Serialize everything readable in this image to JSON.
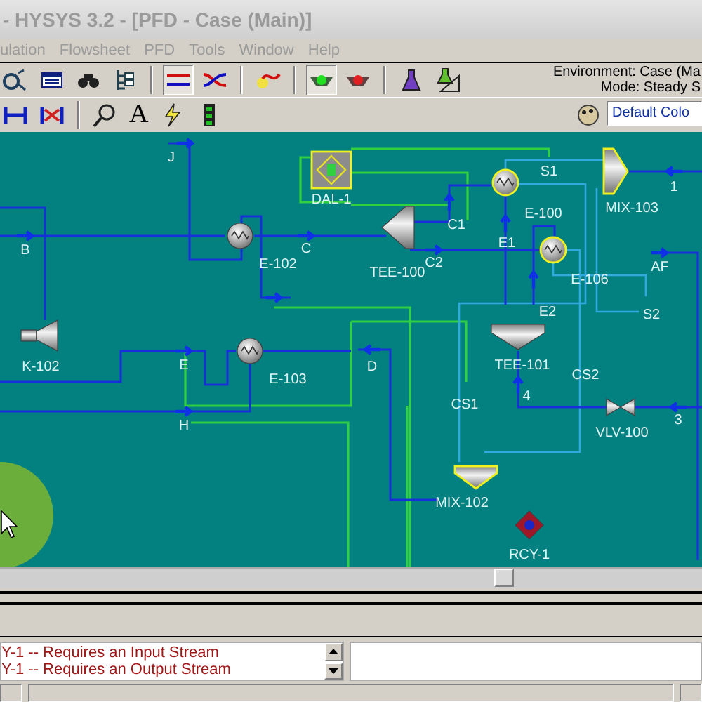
{
  "window": {
    "title": "- HYSYS 3.2 - [PFD - Case (Main)]"
  },
  "menu": [
    "ulation",
    "Flowsheet",
    "PFD",
    "Tools",
    "Window",
    "Help"
  ],
  "environment": {
    "environment": "Environment: Case (Ma",
    "mode": "Mode: Steady S"
  },
  "toolbar": {
    "text_tool": "A",
    "color_scheme": "Default Colo"
  },
  "units": [
    {
      "label": "DAL-1",
      "kind": "balance",
      "highlighted": true
    },
    {
      "label": "E-102",
      "kind": "exchanger",
      "highlighted": false
    },
    {
      "label": "E-103",
      "kind": "exchanger",
      "highlighted": false
    },
    {
      "label": "K-102",
      "kind": "compressor",
      "highlighted": false
    },
    {
      "label": "TEE-100",
      "kind": "splitter",
      "highlighted": false
    },
    {
      "label": "E-100",
      "kind": "exchanger",
      "highlighted": true
    },
    {
      "label": "E-106",
      "kind": "exchanger",
      "highlighted": true
    },
    {
      "label": "TEE-101",
      "kind": "splitter",
      "highlighted": false
    },
    {
      "label": "MIX-103",
      "kind": "mixer",
      "highlighted": true
    },
    {
      "label": "MIX-102",
      "kind": "mixer",
      "highlighted": true
    },
    {
      "label": "VLV-100",
      "kind": "valve",
      "highlighted": false
    },
    {
      "label": "RCY-1",
      "kind": "recycle",
      "highlighted": false
    }
  ],
  "streams": [
    {
      "label": "J"
    },
    {
      "label": "B"
    },
    {
      "label": "C"
    },
    {
      "label": "E"
    },
    {
      "label": "H"
    },
    {
      "label": "D"
    },
    {
      "label": "C1"
    },
    {
      "label": "C2"
    },
    {
      "label": "E1"
    },
    {
      "label": "E2"
    },
    {
      "label": "S1"
    },
    {
      "label": "S2"
    },
    {
      "label": "AF"
    },
    {
      "label": "CS1"
    },
    {
      "label": "CS2"
    },
    {
      "label": "4"
    },
    {
      "label": "3"
    },
    {
      "label": "1"
    }
  ],
  "messages": [
    "Y-1 -- Requires an Input Stream",
    "Y-1 -- Requires an Output Stream"
  ]
}
